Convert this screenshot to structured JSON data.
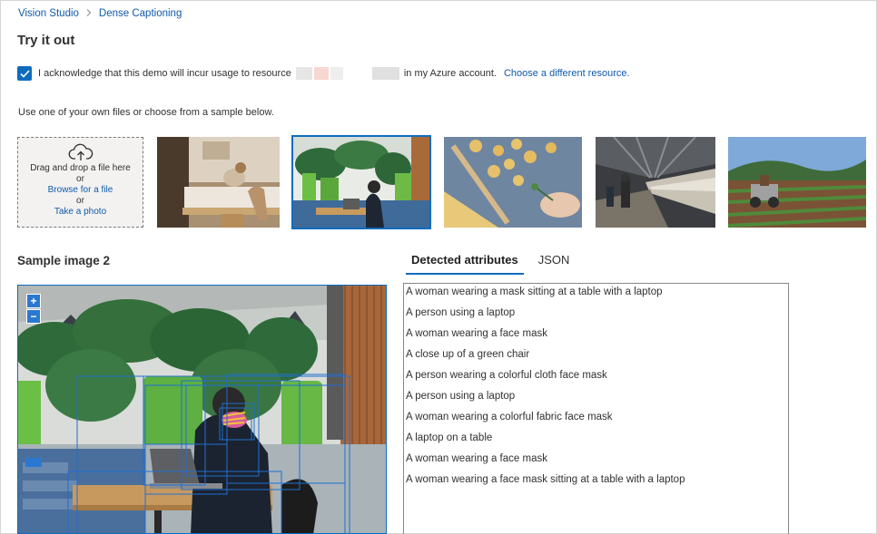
{
  "breadcrumb": {
    "root": "Vision Studio",
    "separator": ">",
    "current": "Dense Captioning"
  },
  "page_title": "Try it out",
  "acknowledge": {
    "checked": true,
    "text_before": "I acknowledge that this demo will incur usage to resource",
    "text_after": "in my Azure account.",
    "link": "Choose a different resource."
  },
  "instruction": "Use one of your own files or choose from a sample below.",
  "dropzone": {
    "line1": "Drag and drop a file here",
    "or1": "or",
    "browse": "Browse for a file",
    "or2": "or",
    "photo": "Take a photo"
  },
  "samples": [
    {
      "icon": "woman-with-dog-photo",
      "selected": false
    },
    {
      "icon": "woman-with-laptop-photo",
      "selected": true
    },
    {
      "icon": "pasta-photo",
      "selected": false
    },
    {
      "icon": "train-station-photo",
      "selected": false
    },
    {
      "icon": "tractor-field-photo",
      "selected": false
    }
  ],
  "sample_title": "Sample image 2",
  "tabs": [
    {
      "label": "Detected attributes",
      "active": true
    },
    {
      "label": "JSON",
      "active": false
    }
  ],
  "zoom": {
    "in": "+",
    "out": "−"
  },
  "detected": [
    "A woman wearing a mask sitting at a table with a laptop",
    "A person using a laptop",
    "A woman wearing a face mask",
    "A close up of a green chair",
    "A person wearing a colorful cloth face mask",
    "A person using a laptop",
    "A woman wearing a colorful fabric face mask",
    "A laptop on a table",
    "A woman wearing a face mask",
    "A woman wearing a face mask sitting at a table with a laptop"
  ],
  "colors": {
    "accent": "#0f6cbd",
    "link": "#0f5aa8"
  }
}
